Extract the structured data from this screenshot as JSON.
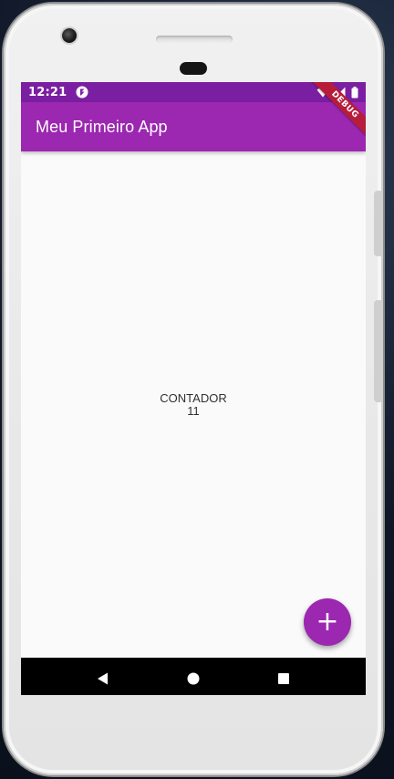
{
  "status_bar": {
    "time": "12:21",
    "icons": [
      "flutter-icon",
      "wifi-icon",
      "signal-icon",
      "battery-icon"
    ]
  },
  "app_bar": {
    "title": "Meu Primeiro App"
  },
  "debug_banner": {
    "label": "DEBUG"
  },
  "body": {
    "label": "CONTADOR",
    "value": "11"
  },
  "fab": {
    "icon": "add-icon",
    "label": "+"
  },
  "nav_bar": {
    "icons": [
      "back-icon",
      "home-icon",
      "recents-icon"
    ]
  },
  "colors": {
    "primary": "#9c27b0",
    "primary_dark": "#7b1fa2",
    "background": "#fafafa",
    "debug_ribbon": "#b71c3a"
  }
}
